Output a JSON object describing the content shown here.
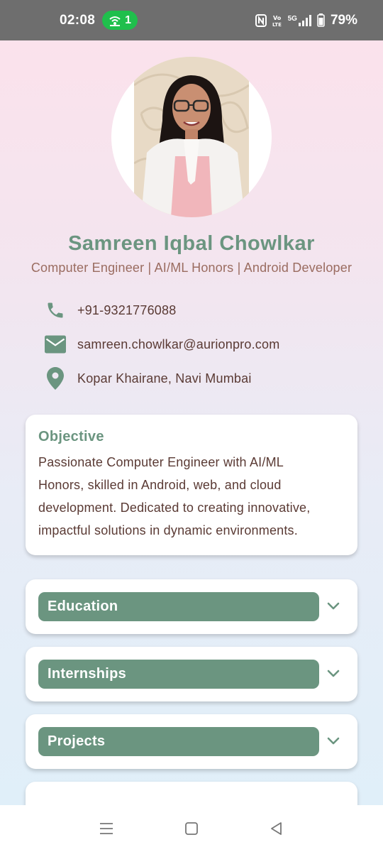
{
  "status_bar": {
    "time": "02:08",
    "hotspot_count": "1",
    "network_label": "5G",
    "battery_percent": "79%"
  },
  "profile": {
    "name": "Samreen Iqbal Chowlkar",
    "headline": "Computer Engineer | AI/ML Honors | Android Developer"
  },
  "contacts": {
    "phone": "+91-9321776088",
    "email": "samreen.chowlkar@aurionpro.com",
    "location": "Kopar Khairane, Navi Mumbai"
  },
  "objective": {
    "title": "Objective",
    "lines": [
      "Passionate Computer Engineer with AI/ML",
      "Honors, skilled in Android, web, and cloud",
      "development. Dedicated to creating innovative,",
      "impactful solutions in dynamic environments."
    ]
  },
  "sections": [
    {
      "label": "Education"
    },
    {
      "label": "Internships"
    },
    {
      "label": "Projects"
    }
  ],
  "colors": {
    "accent": "#6b9580",
    "text": "#5a3a34",
    "subtitle": "#9a6c60"
  },
  "icons": {
    "phone": "phone-icon",
    "email": "email-icon",
    "location": "location-pin-icon",
    "chevron": "chevron-down-icon"
  }
}
